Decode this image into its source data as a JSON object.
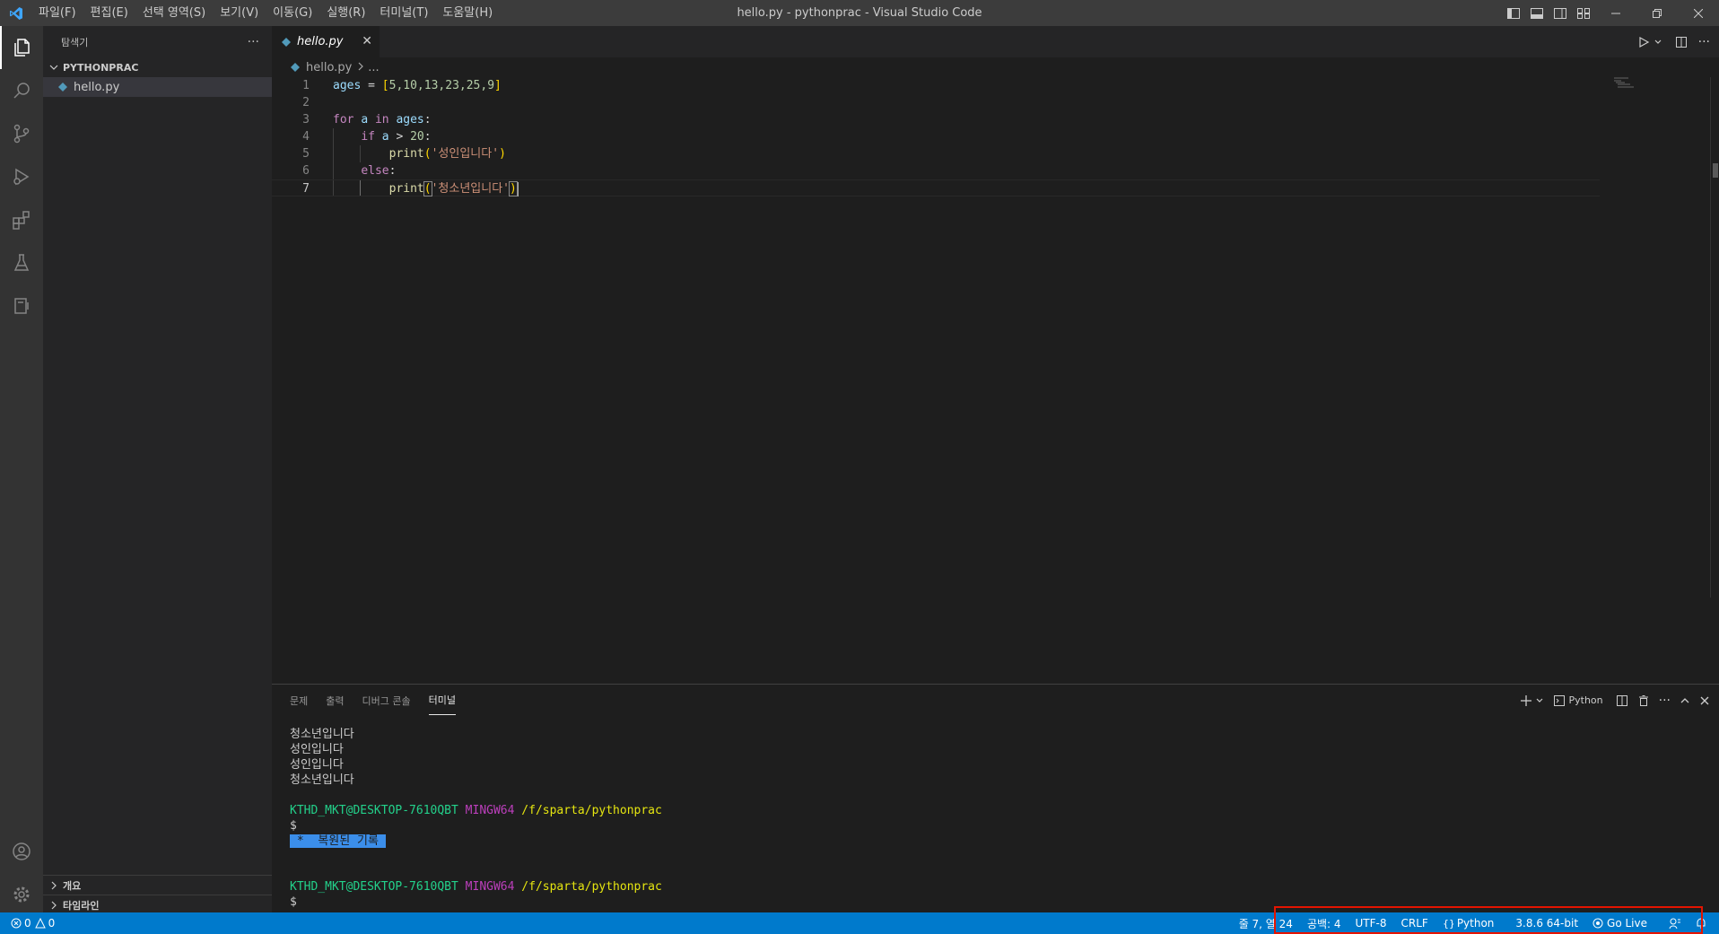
{
  "window": {
    "title": "hello.py - pythonprac - Visual Studio Code",
    "menu": [
      "파일(F)",
      "편집(E)",
      "선택 영역(S)",
      "보기(V)",
      "이동(G)",
      "실행(R)",
      "터미널(T)",
      "도움말(H)"
    ]
  },
  "sidebar": {
    "header": "탐색기",
    "folder": "PYTHONPRAC",
    "files": [
      "hello.py"
    ],
    "outline": "개요",
    "timeline": "타임라인"
  },
  "editor": {
    "tab": "hello.py",
    "breadcrumb_file": "hello.py",
    "breadcrumb_more": "...",
    "line_numbers": [
      "1",
      "2",
      "3",
      "4",
      "5",
      "6",
      "7"
    ]
  },
  "code": {
    "l1_var": "ages",
    "l1_eq": " = ",
    "l1_open": "[",
    "l1_nums": "5,10,13,23,25,9",
    "l1_close": "]",
    "l3_for": "for",
    "l3_a": "a",
    "l3_in": "in",
    "l3_ages": "ages",
    "l3_colon": ":",
    "l4_if": "if",
    "l4_a": "a",
    "l4_gt": " > ",
    "l4_num": "20",
    "l4_colon": ":",
    "print": "print",
    "l5_str": "'성인입니다'",
    "l6_else": "else",
    "l6_colon": ":",
    "l7_str": "'청소년입니다'",
    "open_paren": "(",
    "close_paren": ")"
  },
  "panel": {
    "tabs": [
      "문제",
      "출력",
      "디버그 콘솔",
      "터미널"
    ],
    "active_tab": "터미널",
    "shell_label": "Python"
  },
  "terminal": {
    "output": [
      "청소년입니다",
      "성인입니다",
      "성인입니다",
      "청소년입니다"
    ],
    "user_host": "KTHD_MKT@DESKTOP-7610QBT",
    "mingw": "MINGW64",
    "path": "/f/sparta/pythonprac",
    "prompt": "$",
    "restored_star": "*",
    "restored_text": "복원된 기록"
  },
  "statusbar": {
    "errors": "0",
    "warnings": "0",
    "position": "줄 7, 열 24",
    "spaces": "공백: 4",
    "encoding": "UTF-8",
    "eol": "CRLF",
    "language": "Python",
    "interpreter": "3.8.6 64-bit",
    "golive": "Go Live"
  },
  "colors": {
    "accent": "#007acc",
    "highlight": "#e51400"
  }
}
